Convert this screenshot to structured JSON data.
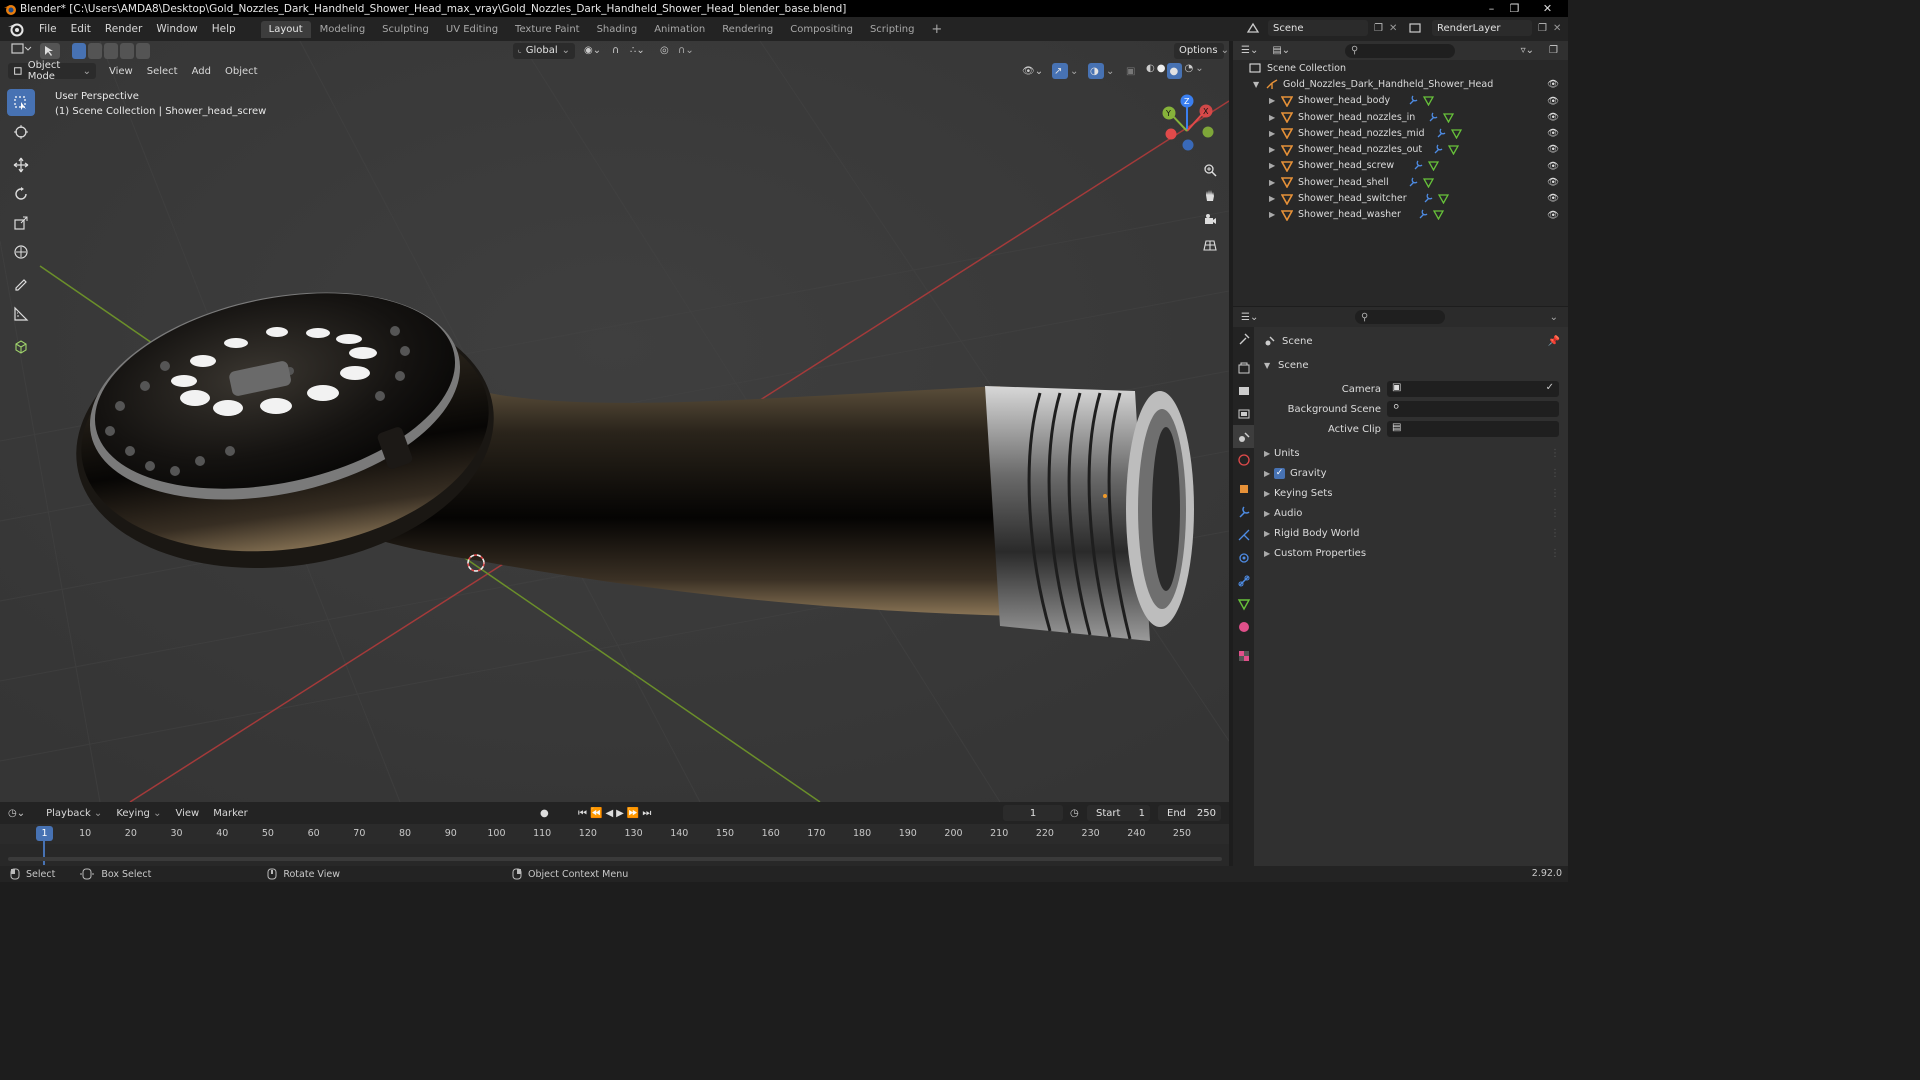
{
  "window": {
    "title": "Blender* [C:\\Users\\AMDA8\\Desktop\\Gold_Nozzles_Dark_Handheld_Shower_Head_max_vray\\Gold_Nozzles_Dark_Handheld_Shower_Head_blender_base.blend]"
  },
  "menu": {
    "items": [
      "File",
      "Edit",
      "Render",
      "Window",
      "Help"
    ],
    "workspaces": [
      "Layout",
      "Modeling",
      "Sculpting",
      "UV Editing",
      "Texture Paint",
      "Shading",
      "Animation",
      "Rendering",
      "Compositing",
      "Scripting"
    ],
    "active_workspace": "Layout",
    "scene_name": "Scene",
    "render_layer": "RenderLayer"
  },
  "viewport": {
    "orientation": "Global",
    "options_label": "Options",
    "mode": "Object Mode",
    "menus": [
      "View",
      "Select",
      "Add",
      "Object"
    ],
    "perspective_label": "User Perspective",
    "context_label": "(1) Scene Collection | Shower_head_screw",
    "gizmo": {
      "x": "X",
      "y": "Y",
      "z": "Z"
    }
  },
  "outliner": {
    "root": "Scene Collection",
    "collection": "Gold_Nozzles_Dark_Handheld_Shower_Head",
    "objects": [
      "Shower_head_body",
      "Shower_head_nozzles_in",
      "Shower_head_nozzles_mid",
      "Shower_head_nozzles_out",
      "Shower_head_screw",
      "Shower_head_shell",
      "Shower_head_switcher",
      "Shower_head_washer"
    ]
  },
  "properties": {
    "context": "Scene",
    "panel_title": "Scene",
    "fields": {
      "camera": "Camera",
      "background_scene": "Background Scene",
      "active_clip": "Active Clip"
    },
    "subpanels": [
      "Units",
      "Gravity",
      "Keying Sets",
      "Audio",
      "Rigid Body World",
      "Custom Properties"
    ],
    "gravity_checked": true
  },
  "timeline": {
    "menus": [
      "Playback",
      "Keying",
      "View",
      "Marker"
    ],
    "current_frame": "1",
    "start_label": "Start",
    "start": "1",
    "end_label": "End",
    "end": "250",
    "ticks": [
      "1",
      "10",
      "20",
      "30",
      "40",
      "50",
      "60",
      "70",
      "80",
      "90",
      "100",
      "110",
      "120",
      "130",
      "140",
      "150",
      "160",
      "170",
      "180",
      "190",
      "200",
      "210",
      "220",
      "230",
      "240",
      "250"
    ]
  },
  "statusbar": {
    "items": [
      "Select",
      "Box Select",
      "Rotate View",
      "Object Context Menu"
    ],
    "version": "2.92.0"
  },
  "colors": {
    "accent": "#4772b3",
    "object_orange": "#e69138",
    "mesh_green": "#67c23a",
    "axis_x": "#e04a4a",
    "axis_y": "#86b33a",
    "axis_z": "#3a7ff0"
  }
}
